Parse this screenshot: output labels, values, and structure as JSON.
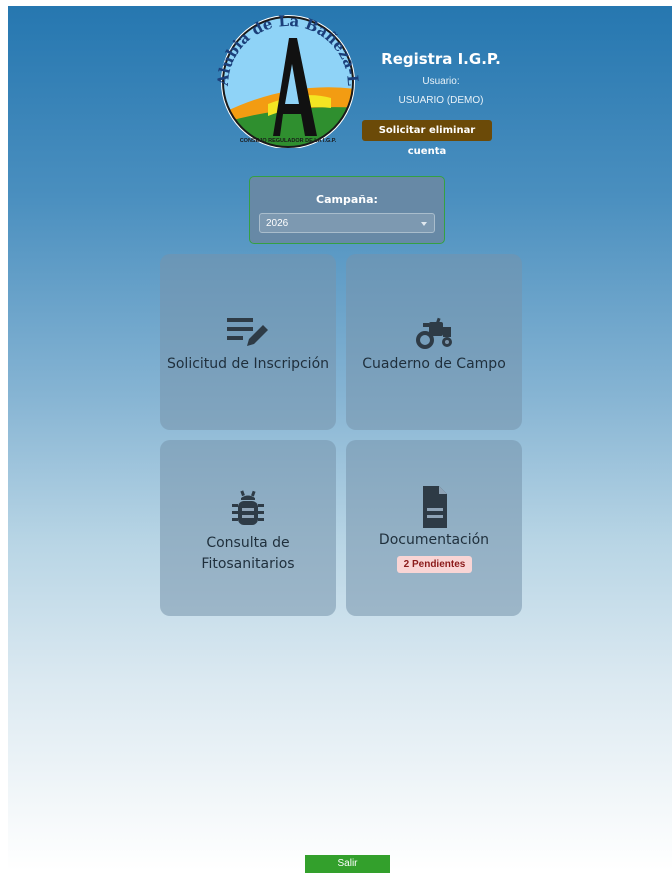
{
  "header": {
    "logo_text": "Alubia de La Bañeza-León",
    "logo_subtext": "CONSEJO REGULADOR DE LA I.G.P.",
    "app_title": "Registra I.G.P.",
    "user_label": "Usuario:",
    "user_name": "USUARIO (DEMO)",
    "delete_account_label": "Solicitar eliminar cuenta"
  },
  "campaign": {
    "label": "Campaña:",
    "selected": "2026"
  },
  "tiles": [
    {
      "label": "Solicitud de Inscripción",
      "icon": "edit-list-icon"
    },
    {
      "label": "Cuaderno de Campo",
      "icon": "tractor-icon"
    },
    {
      "label_line1": "Consulta de",
      "label_line2": "Fitosanitarios",
      "icon": "bug-icon"
    },
    {
      "label": "Documentación",
      "icon": "document-icon",
      "badge": "2 Pendientes"
    }
  ],
  "footer": {
    "exit_label": "Salir"
  },
  "colors": {
    "delete_button": "#6b4a08",
    "exit_button": "#33a02c",
    "season_border": "#35a043",
    "badge_bg": "#f9d5d5",
    "badge_text": "#8b1a1a"
  }
}
